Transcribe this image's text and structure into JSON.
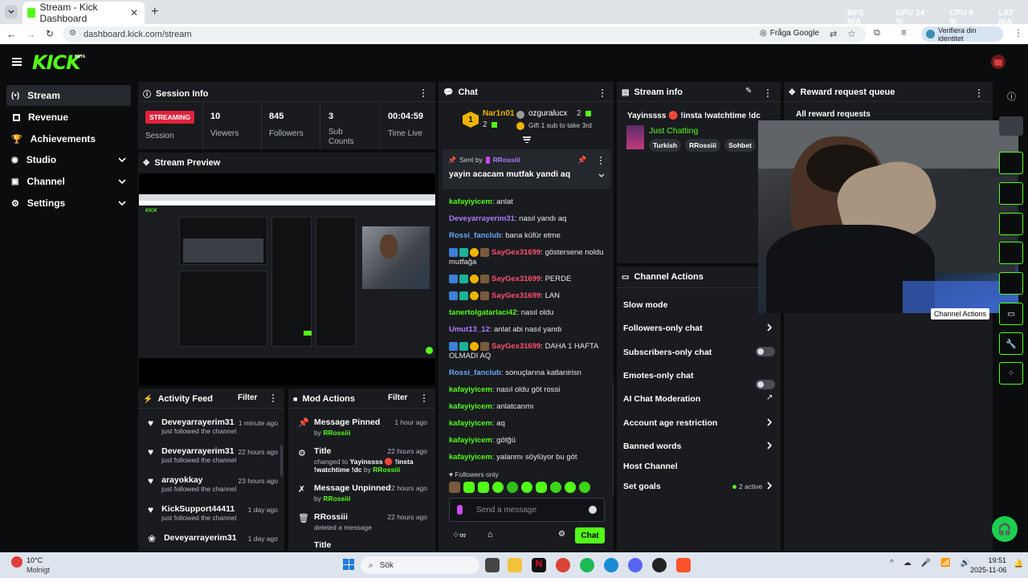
{
  "browser": {
    "tab_title": "Stream - Kick Dashboard",
    "url": "dashboard.kick.com/stream",
    "ask_google": "Fråga Google",
    "identity": "Verifiera din identitet",
    "perf": [
      "BPS N/A",
      "GPU 24 %",
      "CPU 9 %",
      "LAT N/A"
    ]
  },
  "kick": {
    "logo": "KICK",
    "beta": "BETA"
  },
  "sidebar": {
    "items": [
      {
        "label": "Stream",
        "icon": "stream-icon"
      },
      {
        "label": "Revenue",
        "icon": "revenue-icon"
      },
      {
        "label": "Achievements",
        "icon": "trophy-icon"
      },
      {
        "label": "Studio",
        "icon": "studio-icon"
      },
      {
        "label": "Channel",
        "icon": "channel-icon"
      },
      {
        "label": "Settings",
        "icon": "gear-icon"
      }
    ]
  },
  "session": {
    "title": "Session Info",
    "badge": "STREAMING",
    "session_label": "Session",
    "stats": [
      {
        "value": "10",
        "label": "Viewers"
      },
      {
        "value": "845",
        "label": "Followers"
      },
      {
        "value": "3",
        "label": "Sub Counts"
      },
      {
        "value": "00:04:59",
        "label": "Time Live"
      }
    ]
  },
  "preview": {
    "title": "Stream Preview"
  },
  "activity": {
    "title": "Activity Feed",
    "filter": "Filter",
    "items": [
      {
        "name": "Deveyarrayerim31",
        "sub": "just followed the channel",
        "time": "1 minute ago"
      },
      {
        "name": "Deveyarrayerim31",
        "sub": "just followed the channel",
        "time": "22 hours ago"
      },
      {
        "name": "arayokkay",
        "sub": "just followed the channel",
        "time": "23 hours ago"
      },
      {
        "name": "KickSupport44411",
        "sub": "just followed the channel",
        "time": "1 day ago"
      },
      {
        "name": "Deveyarrayerim31",
        "sub": "",
        "time": "1 day ago"
      }
    ]
  },
  "mod": {
    "title": "Mod Actions",
    "filter": "Filter",
    "items": [
      {
        "title": "Message Pinned",
        "line1": "by",
        "user": "RRossiii",
        "time": "1 hour ago"
      },
      {
        "title": "Title",
        "line1": "changed to",
        "user": "Yayinssss 🔴 !insta !watchtime !dc",
        "line2": "by",
        "user2": "RRossiii",
        "time": "22 hours ago"
      },
      {
        "title": "Message Unpinned",
        "line1": "by",
        "user": "RRossiii",
        "time": "22 hours ago"
      },
      {
        "title": "RRossiii",
        "line1": "deleted a message",
        "user": "",
        "time": "22 hours ago"
      },
      {
        "title": "Title",
        "line1": "",
        "user": "",
        "time": ""
      }
    ]
  },
  "chat": {
    "title": "Chat",
    "top": [
      {
        "name": "Nar1n01",
        "count": "2"
      },
      {
        "name": "ozguralucx",
        "count": "2",
        "gift": "Gift 1 sub to take 3rd"
      }
    ],
    "pinned": {
      "sent_by": "Sent by",
      "user": "RRossiii",
      "text": "yayin acacam mutfak yandi aq"
    },
    "messages": [
      {
        "user": "kafayiyicem",
        "color": "#53fc18",
        "text": "anlat",
        "badges": false
      },
      {
        "user": "Deveyarrayerim31",
        "color": "#b07bff",
        "text": "nasıl yandı aq",
        "badges": false
      },
      {
        "user": "Rossi_fanclub",
        "color": "#6aa8ff",
        "text": "bana küfür etme",
        "badges": false
      },
      {
        "user": "SayGex31699",
        "color": "#ff4d6d",
        "text": "göstersene noldu mutfağa",
        "badges": true
      },
      {
        "user": "SayGex31699",
        "color": "#ff4d6d",
        "text": "PERDE",
        "badges": true
      },
      {
        "user": "SayGex31699",
        "color": "#ff4d6d",
        "text": "LAN",
        "badges": true
      },
      {
        "user": "tanertolgatarlaci42",
        "color": "#53fc18",
        "text": "nasıl oldu",
        "badges": false
      },
      {
        "user": "Umut13_12",
        "color": "#b07bff",
        "text": "anlat abi nasıl yandı",
        "badges": false
      },
      {
        "user": "SayGex31699",
        "color": "#ff4d6d",
        "text": "DAHA 1 HAFTA OLMADI AQ",
        "badges": true
      },
      {
        "user": "Rossi_fanclub",
        "color": "#6aa8ff",
        "text": "sonuçlarına katlanirisn",
        "badges": false
      },
      {
        "user": "kafayiyicem",
        "color": "#53fc18",
        "text": "nasıl oldu göt rossi",
        "badges": false
      },
      {
        "user": "kafayiyicem",
        "color": "#53fc18",
        "text": "anlatcanmı",
        "badges": false
      },
      {
        "user": "kafayiyicem",
        "color": "#53fc18",
        "text": "aq",
        "badges": false
      },
      {
        "user": "kafayiyicem",
        "color": "#53fc18",
        "text": "götğü",
        "badges": false
      },
      {
        "user": "kafayiyicem",
        "color": "#53fc18",
        "text": "yalanmı söylüyor bu göt",
        "badges": false
      }
    ],
    "followers_only": "Followers only",
    "placeholder": "Send a message",
    "send": "Chat"
  },
  "stream_info": {
    "title": "Stream info",
    "stream_title": "Yayinssss 🔴 !insta !watchtime !dc",
    "category": "Just Chatting",
    "tags": [
      "Turkish",
      "RRossiii",
      "Sohbet"
    ]
  },
  "channel_actions": {
    "title": "Channel Actions",
    "items": [
      {
        "label": "Slow mode",
        "control": "none"
      },
      {
        "label": "Followers-only chat",
        "control": "chevron"
      },
      {
        "label": "Subscribers-only chat",
        "control": "toggle"
      },
      {
        "label": "Emotes-only chat",
        "control": "toggle"
      },
      {
        "label": "AI Chat Moderation",
        "control": "external"
      },
      {
        "label": "Account age restriction",
        "control": "chevron"
      },
      {
        "label": "Banned words",
        "control": "chevron"
      },
      {
        "label": "Host Channel",
        "control": "none"
      },
      {
        "label": "Set goals",
        "control": "chevron",
        "extra": "2 active"
      }
    ]
  },
  "reward": {
    "title": "Reward request queue",
    "all": "All reward requests"
  },
  "tooltip": "Channel Actions",
  "taskbar": {
    "temp": "10°C",
    "weather": "Molnigt",
    "search": "Sök",
    "time": "19:51",
    "date": "2025-11-06"
  },
  "colors": {
    "accent": "#53fc18",
    "streaming": "#e0223b"
  }
}
